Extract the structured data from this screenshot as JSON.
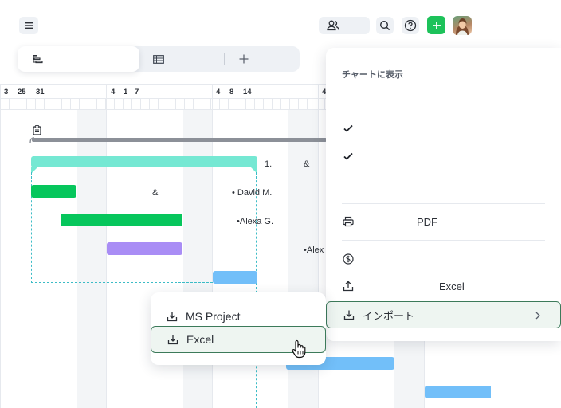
{
  "toolbar": {
    "menu_icon": "hamburger-icon",
    "people_icon": "people-icon",
    "search_icon": "search-icon",
    "help_icon": "help-icon",
    "add_icon": "plus-icon",
    "add_color": "#1dc25a"
  },
  "view_switch": {
    "tabs": [
      {
        "icon": "gantt-icon",
        "active": true
      },
      {
        "icon": "table-icon",
        "active": false
      },
      {
        "icon": "plus-icon",
        "active": false
      }
    ]
  },
  "timeline": {
    "days": [
      "3",
      "25",
      "31",
      "4",
      "1",
      "7",
      "4",
      "8",
      "14",
      "4"
    ],
    "labels": [
      "1.",
      "&",
      "&",
      "• David M.",
      "•Alexa G.",
      "•Alex"
    ],
    "bar_colors": {
      "summary": "#75e8d3",
      "green": "#06c65c",
      "purple": "#a98df5",
      "blue": "#72bff9",
      "milestone": "#8c9098"
    }
  },
  "panel": {
    "title": "チャートに表示",
    "pdf_label": "PDF",
    "excel_label": "Excel",
    "import_label": "インポート"
  },
  "submenu": {
    "items": [
      "MS Project",
      "Excel"
    ],
    "highlight_color": "#3c7a5a"
  }
}
